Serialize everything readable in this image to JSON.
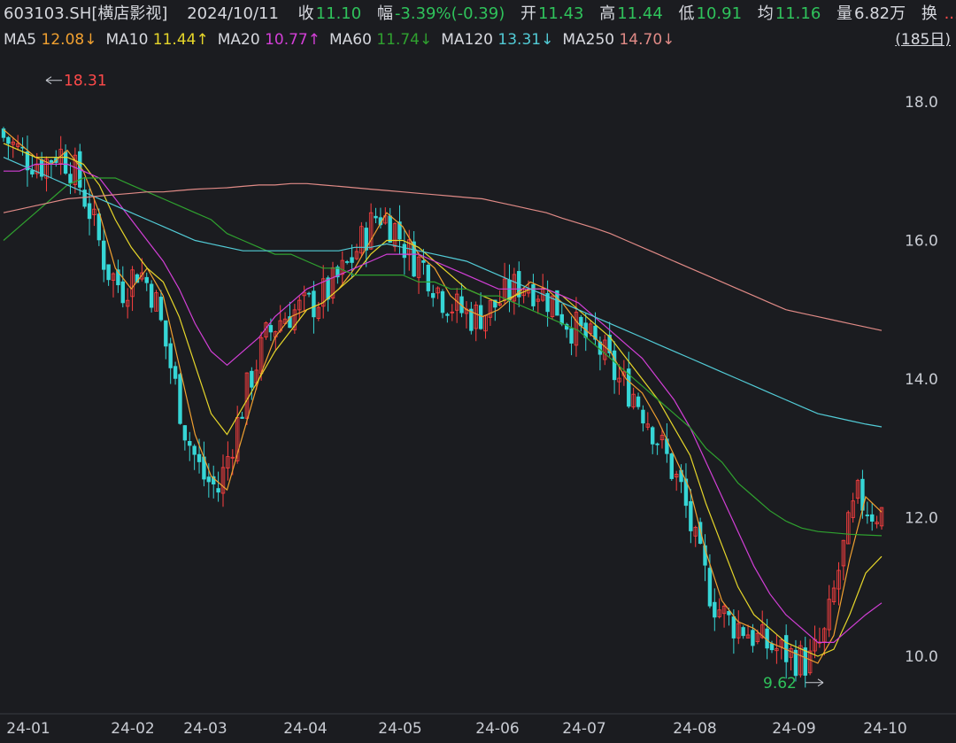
{
  "header": {
    "symbol": "603103.SH[横店影视]",
    "date": "2024/10/11",
    "close_label": "收",
    "close": "11.10",
    "change_label": "幅",
    "change": "-3.39%(-0.39)",
    "open_label": "开",
    "open": "11.43",
    "high_label": "高",
    "high": "11.44",
    "low_label": "低",
    "low": "10.91",
    "avg_label": "均",
    "avg": "11.16",
    "vol_label": "量",
    "volume": "6.82万",
    "more_label": "换",
    "more_dots": "..."
  },
  "ma_legend": [
    {
      "label": "MA5",
      "value": "12.08↓",
      "color": "#f0a030"
    },
    {
      "label": "MA10",
      "value": "11.44↑",
      "color": "#e6d62a"
    },
    {
      "label": "MA20",
      "value": "10.77↑",
      "color": "#d23fd6"
    },
    {
      "label": "MA60",
      "value": "11.74↓",
      "color": "#2fa12f"
    },
    {
      "label": "MA120",
      "value": "13.31↓",
      "color": "#52cbd6"
    },
    {
      "label": "MA250",
      "value": "14.70↓",
      "color": "#e08a86"
    }
  ],
  "range_button": "(185日)",
  "colors": {
    "up": "#ff4040",
    "down": "#36d6d6",
    "grid": "#2a2c32"
  },
  "chart_data": {
    "type": "candlestick",
    "x_labels": [
      "24-01",
      "24-02",
      "24-03",
      "24-04",
      "24-05",
      "24-06",
      "24-07",
      "24-08",
      "24-09",
      "24-10"
    ],
    "y_ticks": [
      "18.0",
      "16.0",
      "14.0",
      "12.0",
      "10.0"
    ],
    "ylim": [
      9.4,
      18.6
    ],
    "annotations": {
      "high": "18.31",
      "low": "9.62"
    },
    "series": [
      {
        "name": "MA5",
        "values": [
          17.6,
          17.4,
          17.2,
          17.1,
          17.3,
          17.0,
          16.4,
          15.6,
          15.3,
          15.6,
          15.2,
          14.2,
          13.2,
          12.6,
          12.4,
          13.2,
          14.0,
          14.6,
          14.9,
          15.0,
          15.1,
          15.3,
          15.6,
          16.0,
          16.4,
          16.2,
          15.8,
          15.6,
          15.2,
          15.0,
          14.9,
          15.0,
          15.2,
          15.4,
          15.3,
          15.1,
          14.8,
          14.6,
          14.4,
          14.0,
          13.8,
          13.4,
          12.9,
          12.4,
          11.5,
          10.8,
          10.5,
          10.4,
          10.2,
          10.1,
          10.0,
          9.9,
          10.3,
          11.4,
          12.3,
          12.08
        ]
      },
      {
        "name": "MA10",
        "values": [
          17.4,
          17.3,
          17.2,
          17.2,
          17.2,
          17.1,
          16.8,
          16.3,
          15.9,
          15.6,
          15.4,
          14.9,
          14.2,
          13.5,
          13.2,
          13.6,
          14.0,
          14.4,
          14.7,
          15.0,
          15.1,
          15.3,
          15.5,
          15.8,
          16.0,
          16.0,
          15.9,
          15.7,
          15.5,
          15.3,
          15.2,
          15.1,
          15.2,
          15.3,
          15.3,
          15.2,
          15.0,
          14.8,
          14.6,
          14.3,
          14.0,
          13.7,
          13.3,
          12.9,
          12.2,
          11.6,
          11.0,
          10.6,
          10.4,
          10.2,
          10.1,
          10.0,
          10.1,
          10.6,
          11.2,
          11.44
        ]
      },
      {
        "name": "MA20",
        "values": [
          17.0,
          17.0,
          17.1,
          17.1,
          17.1,
          17.0,
          16.9,
          16.6,
          16.3,
          16.0,
          15.7,
          15.3,
          14.8,
          14.4,
          14.2,
          14.4,
          14.6,
          14.9,
          15.1,
          15.3,
          15.4,
          15.5,
          15.6,
          15.7,
          15.8,
          15.8,
          15.8,
          15.7,
          15.6,
          15.5,
          15.4,
          15.3,
          15.3,
          15.3,
          15.3,
          15.2,
          15.1,
          14.9,
          14.7,
          14.5,
          14.3,
          14.0,
          13.7,
          13.3,
          12.8,
          12.3,
          11.8,
          11.3,
          10.9,
          10.6,
          10.4,
          10.2,
          10.2,
          10.4,
          10.6,
          10.77
        ]
      },
      {
        "name": "MA60",
        "values": [
          16.0,
          16.2,
          16.4,
          16.6,
          16.8,
          16.9,
          16.9,
          16.9,
          16.8,
          16.7,
          16.6,
          16.5,
          16.4,
          16.3,
          16.1,
          16.0,
          15.9,
          15.8,
          15.8,
          15.7,
          15.6,
          15.6,
          15.5,
          15.5,
          15.5,
          15.5,
          15.4,
          15.4,
          15.3,
          15.3,
          15.2,
          15.2,
          15.1,
          15.0,
          14.9,
          14.8,
          14.7,
          14.5,
          14.3,
          14.1,
          13.9,
          13.7,
          13.5,
          13.3,
          13.0,
          12.8,
          12.5,
          12.3,
          12.1,
          11.95,
          11.85,
          11.8,
          11.78,
          11.76,
          11.75,
          11.74
        ]
      },
      {
        "name": "MA120",
        "values": [
          17.2,
          17.1,
          17.0,
          16.9,
          16.8,
          16.7,
          16.6,
          16.5,
          16.4,
          16.3,
          16.2,
          16.1,
          16.0,
          15.95,
          15.9,
          15.85,
          15.85,
          15.85,
          15.85,
          15.85,
          15.85,
          15.85,
          15.9,
          15.9,
          15.95,
          15.9,
          15.85,
          15.8,
          15.75,
          15.7,
          15.6,
          15.5,
          15.4,
          15.3,
          15.2,
          15.1,
          15.0,
          14.9,
          14.8,
          14.7,
          14.6,
          14.5,
          14.4,
          14.3,
          14.2,
          14.1,
          14.0,
          13.9,
          13.8,
          13.7,
          13.6,
          13.5,
          13.45,
          13.4,
          13.35,
          13.31
        ]
      },
      {
        "name": "MA250",
        "values": [
          16.4,
          16.45,
          16.5,
          16.55,
          16.6,
          16.62,
          16.64,
          16.66,
          16.68,
          16.7,
          16.7,
          16.72,
          16.74,
          16.75,
          16.76,
          16.78,
          16.8,
          16.8,
          16.82,
          16.82,
          16.8,
          16.78,
          16.76,
          16.74,
          16.72,
          16.7,
          16.68,
          16.66,
          16.64,
          16.62,
          16.6,
          16.55,
          16.5,
          16.45,
          16.4,
          16.32,
          16.25,
          16.18,
          16.1,
          16.0,
          15.9,
          15.8,
          15.7,
          15.6,
          15.5,
          15.4,
          15.3,
          15.2,
          15.1,
          15.0,
          14.95,
          14.9,
          14.85,
          14.8,
          14.75,
          14.7
        ]
      }
    ]
  }
}
